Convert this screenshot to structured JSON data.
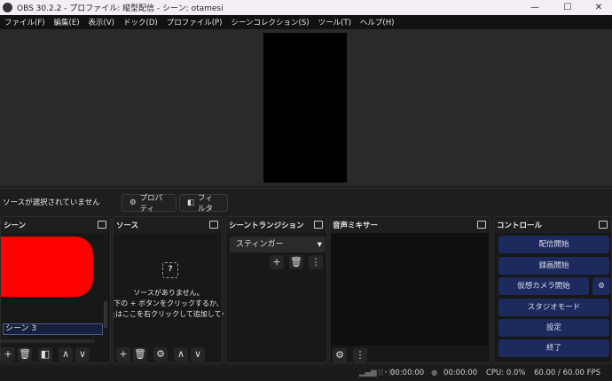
{
  "window": {
    "title": "OBS 30.2.2 - プロファイル: 縦型配信 - シーン: otamesi",
    "minimize": "—",
    "maximize": "☐",
    "close": "✕"
  },
  "menu": [
    "ファイル(F)",
    "編集(E)",
    "表示(V)",
    "ドック(D)",
    "プロファイル(P)",
    "シーンコレクション(S)",
    "ツール(T)",
    "ヘルプ(H)"
  ],
  "source_toolbar": {
    "no_source": "ソースが選択されていません",
    "properties": "プロパティ",
    "filters": "フィルタ"
  },
  "docks": {
    "scenes": {
      "title": "シーン",
      "selected_scene": "シーン 3"
    },
    "sources": {
      "title": "ソース",
      "empty_line1": "ソースがありません。",
      "empty_line2": "下の + ボタンをクリックするか、",
      "empty_line3": "またはここを右クリックして追加してください"
    },
    "transitions": {
      "title": "シーントランジション",
      "selected": "スティンガー"
    },
    "mixer": {
      "title": "音声ミキサー"
    },
    "controls": {
      "title": "コントロール",
      "buttons": [
        "配信開始",
        "録画開始",
        "仮想カメラ開始",
        "スタジオモード",
        "設定",
        "終了"
      ]
    }
  },
  "status": {
    "stream_time": "00:00:00",
    "rec_time": "00:00:00",
    "cpu": "CPU: 0.0%",
    "fps": "60.00 / 60.00 FPS"
  },
  "colors": {
    "control_button": "#1c2a5e",
    "redaction": "#ff0000"
  }
}
